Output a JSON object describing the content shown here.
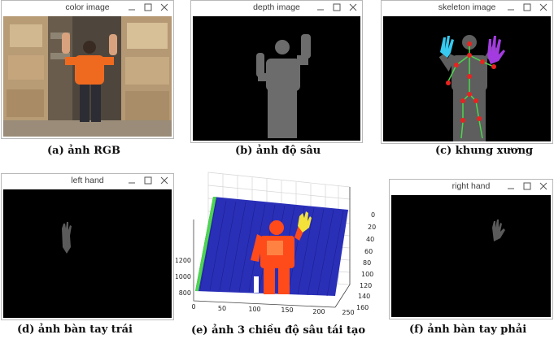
{
  "windows": {
    "color": {
      "title": "color image"
    },
    "depth": {
      "title": "depth image"
    },
    "skeleton": {
      "title": "skeleton image"
    },
    "left": {
      "title": "left hand"
    },
    "right": {
      "title": "right hand"
    }
  },
  "captions": {
    "a": "(a) ảnh RGB",
    "b": "(b) ảnh độ sâu",
    "c": "(c) khung xương",
    "d": "(d) ảnh bàn tay trái",
    "e": "(e) ảnh 3 chiều độ sâu tái tạo",
    "f": "(f) ảnh bàn tay phải"
  },
  "plot3d": {
    "x_ticks": [
      "0",
      "50",
      "100",
      "150",
      "200",
      "250"
    ],
    "y_ticks": [
      "0",
      "20",
      "40",
      "60",
      "80",
      "100",
      "120",
      "140",
      "160"
    ],
    "z_ticks": [
      "800",
      "1000",
      "1200"
    ]
  },
  "colors": {
    "plot_plane": "#2a2fb8",
    "body_near": "#ff4a1a",
    "hand_yellow": "#f2e23a",
    "edge_green": "#4cd64c",
    "hand_cyan": "#37c9ef",
    "hand_purple": "#a33be0",
    "joint_red": "#e8231f"
  }
}
